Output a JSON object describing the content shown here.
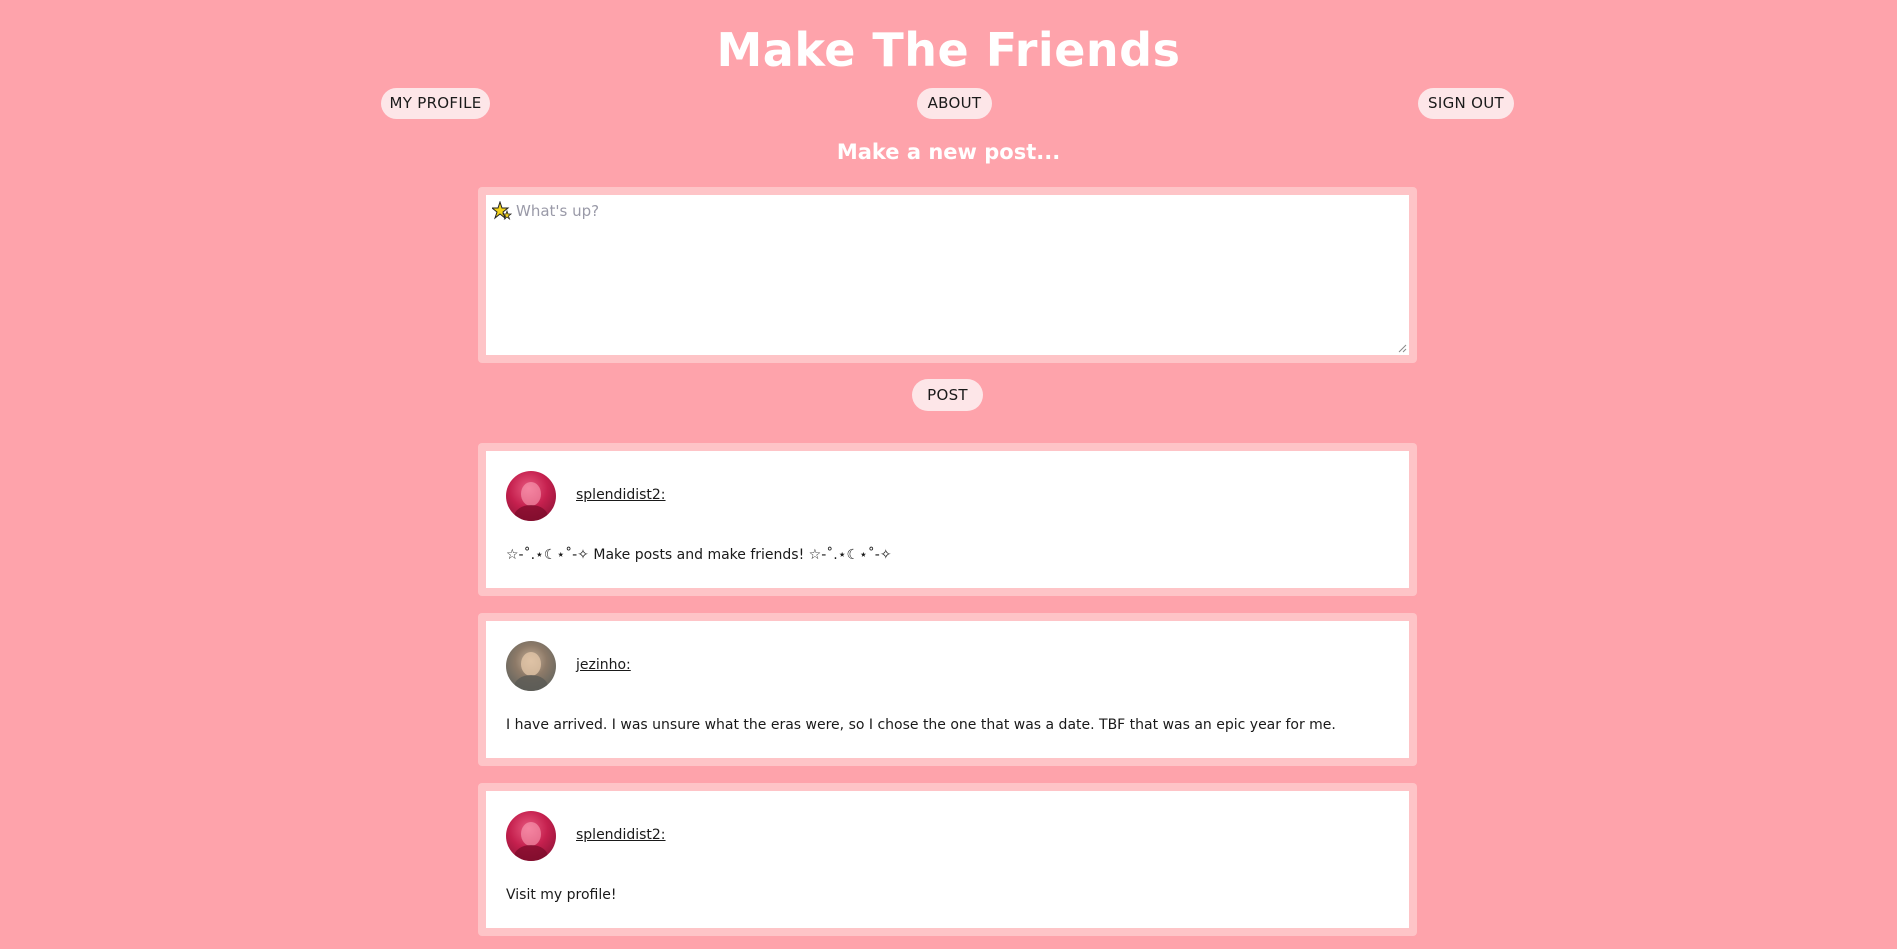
{
  "site": {
    "title": "Make The Friends"
  },
  "nav": {
    "my_profile": "MY PROFILE",
    "about": "ABOUT",
    "sign_out": "SIGN OUT"
  },
  "composer": {
    "heading": "Make a new post...",
    "placeholder": "What's up?",
    "icon": "sparkle-star-icon",
    "submit_label": "POST"
  },
  "posts": [
    {
      "username": "splendidist2:",
      "avatar": "pink-portrait",
      "text": "☆-˚.⋆☾⋆˚-✧ Make posts and make friends! ☆-˚.⋆☾⋆˚-✧"
    },
    {
      "username": "jezinho:",
      "avatar": "grey-portrait",
      "text": "I have arrived. I was unsure what the eras were, so I chose the one that was a date. TBF that was an epic year for me."
    },
    {
      "username": "splendidist2:",
      "avatar": "pink-portrait",
      "text": "Visit my profile!"
    }
  ],
  "colors": {
    "background": "#fea3ab",
    "card_border": "#fec4c7",
    "pill": "#fde6e8",
    "title": "#ffffff"
  }
}
